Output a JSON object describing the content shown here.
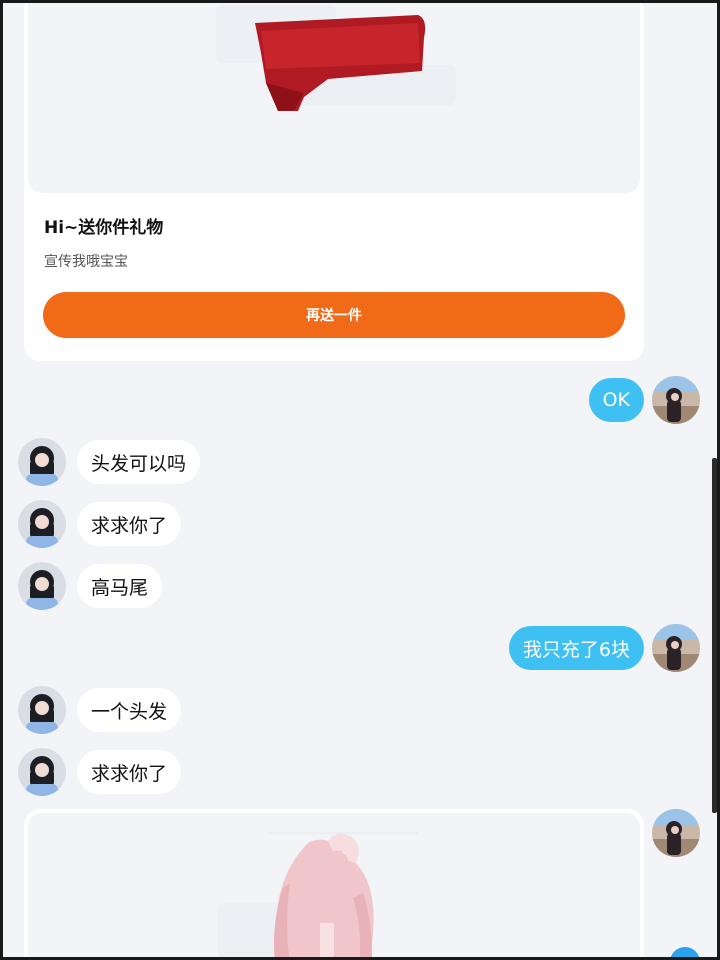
{
  "gift_card": {
    "title": "Hi~送你件礼物",
    "subtitle": "宣传我哦宝宝",
    "button_label": "再送一件"
  },
  "messages": [
    {
      "side": "out",
      "text": "OK"
    },
    {
      "side": "in",
      "text": "头发可以吗"
    },
    {
      "side": "in",
      "text": "求求你了"
    },
    {
      "side": "in",
      "text": "高马尾"
    },
    {
      "side": "out",
      "text": "我只充了6块"
    },
    {
      "side": "in",
      "text": "一个头发"
    },
    {
      "side": "in",
      "text": "求求你了"
    }
  ],
  "colors": {
    "background": "#f3f4f7",
    "outgoing_bubble": "#3ec0f2",
    "incoming_bubble": "#ffffff",
    "button_orange": "#f06a18"
  }
}
